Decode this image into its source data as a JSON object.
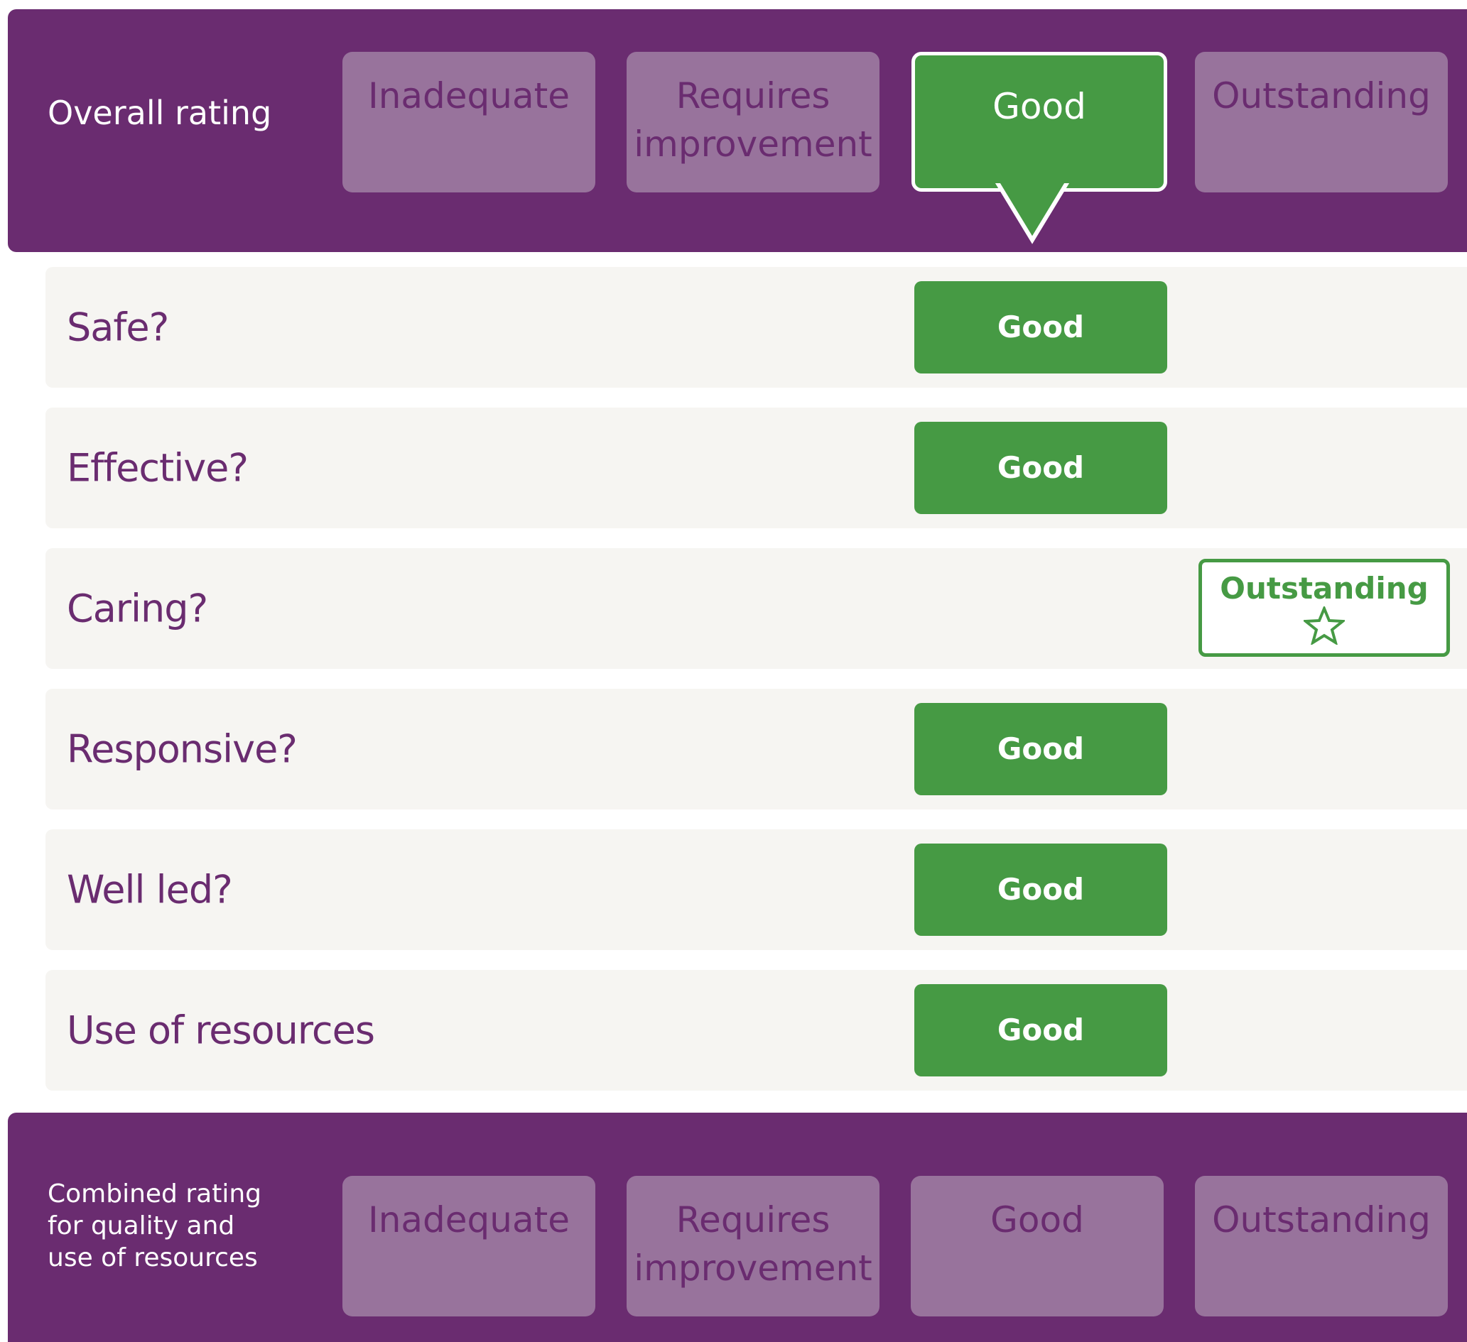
{
  "overall": {
    "label": "Overall rating",
    "options": [
      "Inadequate",
      "Requires improvement",
      "Good",
      "Outstanding"
    ],
    "selected": "Good"
  },
  "domains": [
    {
      "label": "Safe?",
      "rating": "Good"
    },
    {
      "label": "Effective?",
      "rating": "Good"
    },
    {
      "label": "Caring?",
      "rating": "Outstanding"
    },
    {
      "label": "Responsive?",
      "rating": "Good"
    },
    {
      "label": "Well led?",
      "rating": "Good"
    },
    {
      "label": "Use of resources",
      "rating": "Good"
    }
  ],
  "combined": {
    "label": "Combined rating for quality and use of resources",
    "options": [
      "Inadequate",
      "Requires improvement",
      "Good",
      "Outstanding"
    ]
  },
  "colors": {
    "purple": "#6a2c70",
    "muted_purple": "#98739c",
    "green": "#469a44",
    "row_bg": "#f6f5f2"
  },
  "icons": {
    "outstanding_marker": "star-icon",
    "selected_marker": "pointer-arrow-icon"
  }
}
